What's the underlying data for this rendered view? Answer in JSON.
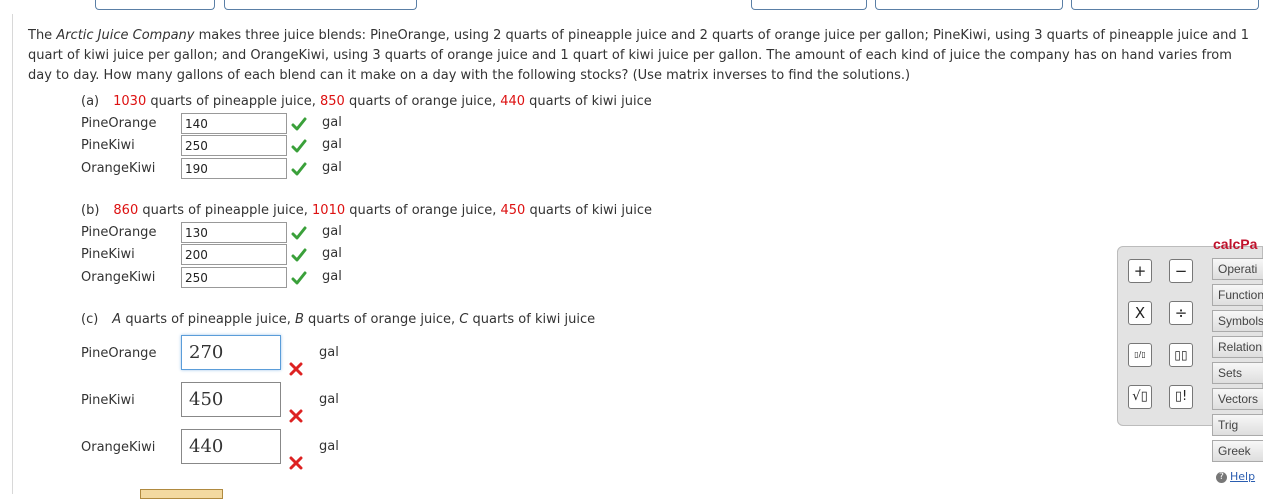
{
  "problem": {
    "p1": "The ",
    "company": "Arctic Juice Company",
    "p2": " makes three juice blends: PineOrange, using 2 quarts of pineapple juice and 2 quarts of orange juice per gallon; PineKiwi, using 3 quarts of pineapple juice and 1 quart of kiwi juice per gallon; and OrangeKiwi, using 3 quarts of orange juice and 1 quart of kiwi juice per gallon. The amount of each kind of juice the company has on hand varies from day to day. How many gallons of each blend can it make on a day with the following stocks? (Use matrix inverses to find the solutions.)"
  },
  "parts": {
    "a": {
      "label": "(a)",
      "pineapple_q": "1030",
      "orange_q": "850",
      "kiwi_q": "440",
      "t_pine": " quarts of pineapple juice, ",
      "t_orange": " quarts of orange juice, ",
      "t_kiwi": " quarts of kiwi juice",
      "rows": [
        {
          "label": "PineOrange",
          "value": "140",
          "unit": "gal"
        },
        {
          "label": "PineKiwi",
          "value": "250",
          "unit": "gal"
        },
        {
          "label": "OrangeKiwi",
          "value": "190",
          "unit": "gal"
        }
      ]
    },
    "b": {
      "label": "(b)",
      "pineapple_q": "860",
      "orange_q": "1010",
      "kiwi_q": "450",
      "t_pine": " quarts of pineapple juice, ",
      "t_orange": " quarts of orange juice, ",
      "t_kiwi": " quarts of kiwi juice",
      "rows": [
        {
          "label": "PineOrange",
          "value": "130",
          "unit": "gal"
        },
        {
          "label": "PineKiwi",
          "value": "200",
          "unit": "gal"
        },
        {
          "label": "OrangeKiwi",
          "value": "250",
          "unit": "gal"
        }
      ]
    },
    "c": {
      "label": "(c)",
      "var_a": "A",
      "var_b": "B",
      "var_c": "C",
      "t_pine": " quarts of pineapple juice, ",
      "t_orange": " quarts of orange juice, ",
      "t_kiwi": " quarts of kiwi juice",
      "rows": [
        {
          "label": "PineOrange",
          "value": "270",
          "unit": "gal"
        },
        {
          "label": "PineKiwi",
          "value": "450",
          "unit": "gal"
        },
        {
          "label": "OrangeKiwi",
          "value": "440",
          "unit": "gal"
        }
      ]
    }
  },
  "calcpad": {
    "title": "calcPa",
    "buttons": {
      "plus": "+",
      "minus": "−",
      "times": "X",
      "divide": "÷",
      "fraction": "▯/▯",
      "power": "▯▯",
      "sqrt": "√▯",
      "factorial": "▯!"
    },
    "categories": [
      "Operati",
      "Function",
      "Symbols",
      "Relation",
      "Sets",
      "Vectors",
      "Trig",
      "Greek"
    ],
    "help": "Help"
  },
  "colors": {
    "red_value": "#dd1111",
    "check_green": "#3aa03a",
    "cross_red": "#dd2222",
    "calc_title": "#c0122c"
  }
}
